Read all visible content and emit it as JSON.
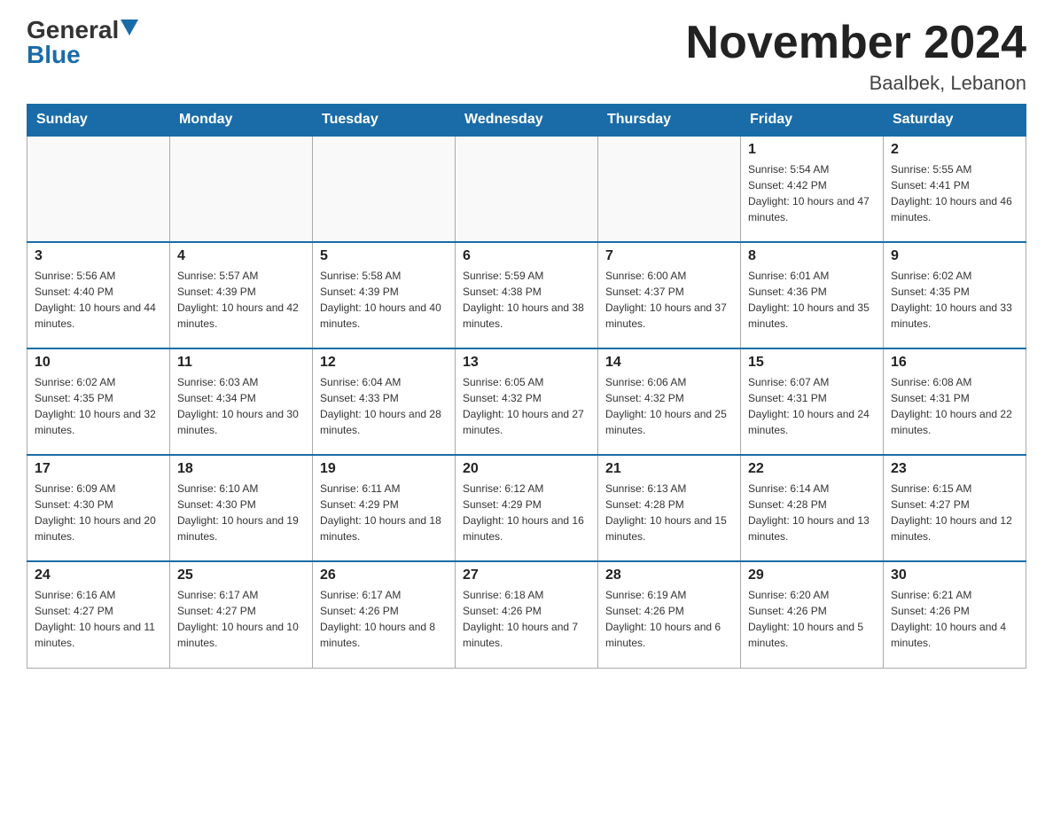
{
  "header": {
    "logo_general": "General",
    "logo_blue": "Blue",
    "month_title": "November 2024",
    "location": "Baalbek, Lebanon"
  },
  "weekdays": [
    "Sunday",
    "Monday",
    "Tuesday",
    "Wednesday",
    "Thursday",
    "Friday",
    "Saturday"
  ],
  "weeks": [
    [
      {
        "day": "",
        "info": ""
      },
      {
        "day": "",
        "info": ""
      },
      {
        "day": "",
        "info": ""
      },
      {
        "day": "",
        "info": ""
      },
      {
        "day": "",
        "info": ""
      },
      {
        "day": "1",
        "info": "Sunrise: 5:54 AM\nSunset: 4:42 PM\nDaylight: 10 hours and 47 minutes."
      },
      {
        "day": "2",
        "info": "Sunrise: 5:55 AM\nSunset: 4:41 PM\nDaylight: 10 hours and 46 minutes."
      }
    ],
    [
      {
        "day": "3",
        "info": "Sunrise: 5:56 AM\nSunset: 4:40 PM\nDaylight: 10 hours and 44 minutes."
      },
      {
        "day": "4",
        "info": "Sunrise: 5:57 AM\nSunset: 4:39 PM\nDaylight: 10 hours and 42 minutes."
      },
      {
        "day": "5",
        "info": "Sunrise: 5:58 AM\nSunset: 4:39 PM\nDaylight: 10 hours and 40 minutes."
      },
      {
        "day": "6",
        "info": "Sunrise: 5:59 AM\nSunset: 4:38 PM\nDaylight: 10 hours and 38 minutes."
      },
      {
        "day": "7",
        "info": "Sunrise: 6:00 AM\nSunset: 4:37 PM\nDaylight: 10 hours and 37 minutes."
      },
      {
        "day": "8",
        "info": "Sunrise: 6:01 AM\nSunset: 4:36 PM\nDaylight: 10 hours and 35 minutes."
      },
      {
        "day": "9",
        "info": "Sunrise: 6:02 AM\nSunset: 4:35 PM\nDaylight: 10 hours and 33 minutes."
      }
    ],
    [
      {
        "day": "10",
        "info": "Sunrise: 6:02 AM\nSunset: 4:35 PM\nDaylight: 10 hours and 32 minutes."
      },
      {
        "day": "11",
        "info": "Sunrise: 6:03 AM\nSunset: 4:34 PM\nDaylight: 10 hours and 30 minutes."
      },
      {
        "day": "12",
        "info": "Sunrise: 6:04 AM\nSunset: 4:33 PM\nDaylight: 10 hours and 28 minutes."
      },
      {
        "day": "13",
        "info": "Sunrise: 6:05 AM\nSunset: 4:32 PM\nDaylight: 10 hours and 27 minutes."
      },
      {
        "day": "14",
        "info": "Sunrise: 6:06 AM\nSunset: 4:32 PM\nDaylight: 10 hours and 25 minutes."
      },
      {
        "day": "15",
        "info": "Sunrise: 6:07 AM\nSunset: 4:31 PM\nDaylight: 10 hours and 24 minutes."
      },
      {
        "day": "16",
        "info": "Sunrise: 6:08 AM\nSunset: 4:31 PM\nDaylight: 10 hours and 22 minutes."
      }
    ],
    [
      {
        "day": "17",
        "info": "Sunrise: 6:09 AM\nSunset: 4:30 PM\nDaylight: 10 hours and 20 minutes."
      },
      {
        "day": "18",
        "info": "Sunrise: 6:10 AM\nSunset: 4:30 PM\nDaylight: 10 hours and 19 minutes."
      },
      {
        "day": "19",
        "info": "Sunrise: 6:11 AM\nSunset: 4:29 PM\nDaylight: 10 hours and 18 minutes."
      },
      {
        "day": "20",
        "info": "Sunrise: 6:12 AM\nSunset: 4:29 PM\nDaylight: 10 hours and 16 minutes."
      },
      {
        "day": "21",
        "info": "Sunrise: 6:13 AM\nSunset: 4:28 PM\nDaylight: 10 hours and 15 minutes."
      },
      {
        "day": "22",
        "info": "Sunrise: 6:14 AM\nSunset: 4:28 PM\nDaylight: 10 hours and 13 minutes."
      },
      {
        "day": "23",
        "info": "Sunrise: 6:15 AM\nSunset: 4:27 PM\nDaylight: 10 hours and 12 minutes."
      }
    ],
    [
      {
        "day": "24",
        "info": "Sunrise: 6:16 AM\nSunset: 4:27 PM\nDaylight: 10 hours and 11 minutes."
      },
      {
        "day": "25",
        "info": "Sunrise: 6:17 AM\nSunset: 4:27 PM\nDaylight: 10 hours and 10 minutes."
      },
      {
        "day": "26",
        "info": "Sunrise: 6:17 AM\nSunset: 4:26 PM\nDaylight: 10 hours and 8 minutes."
      },
      {
        "day": "27",
        "info": "Sunrise: 6:18 AM\nSunset: 4:26 PM\nDaylight: 10 hours and 7 minutes."
      },
      {
        "day": "28",
        "info": "Sunrise: 6:19 AM\nSunset: 4:26 PM\nDaylight: 10 hours and 6 minutes."
      },
      {
        "day": "29",
        "info": "Sunrise: 6:20 AM\nSunset: 4:26 PM\nDaylight: 10 hours and 5 minutes."
      },
      {
        "day": "30",
        "info": "Sunrise: 6:21 AM\nSunset: 4:26 PM\nDaylight: 10 hours and 4 minutes."
      }
    ]
  ]
}
